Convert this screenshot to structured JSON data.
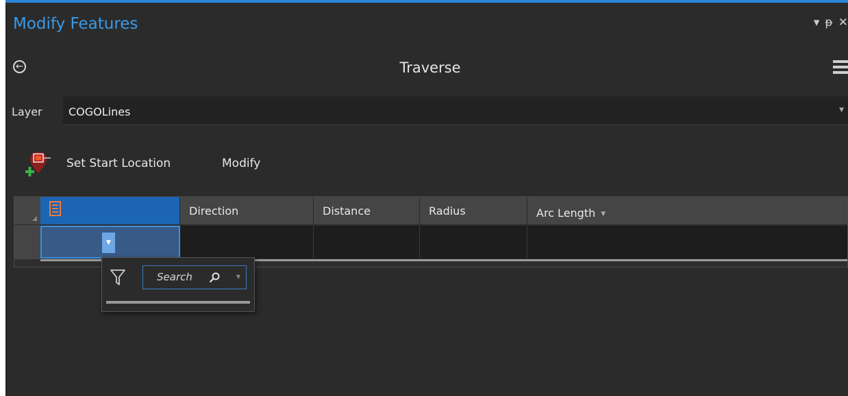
{
  "pane": {
    "title": "Modify Features",
    "controls": {
      "dropdown": "▾",
      "pin": "ᵽ",
      "close": "✕"
    }
  },
  "tool": {
    "title": "Traverse",
    "back_icon": "arrow-left-circle-icon",
    "menu_icon": "hamburger-menu-icon"
  },
  "layer": {
    "label": "Layer",
    "value": "COGOLines"
  },
  "toolbar": {
    "start_label": "Set Start Location",
    "modify_label": "Modify"
  },
  "grid": {
    "columns": [
      "",
      "Direction",
      "Distance",
      "Radius",
      "Arc Length"
    ]
  },
  "dropdown": {
    "search_placeholder": "Search"
  },
  "colors": {
    "accent": "#2b86d6",
    "title_blue": "#3a9ae8",
    "panel_bg": "#2b2b2b",
    "selected_header": "#1c64b4"
  }
}
